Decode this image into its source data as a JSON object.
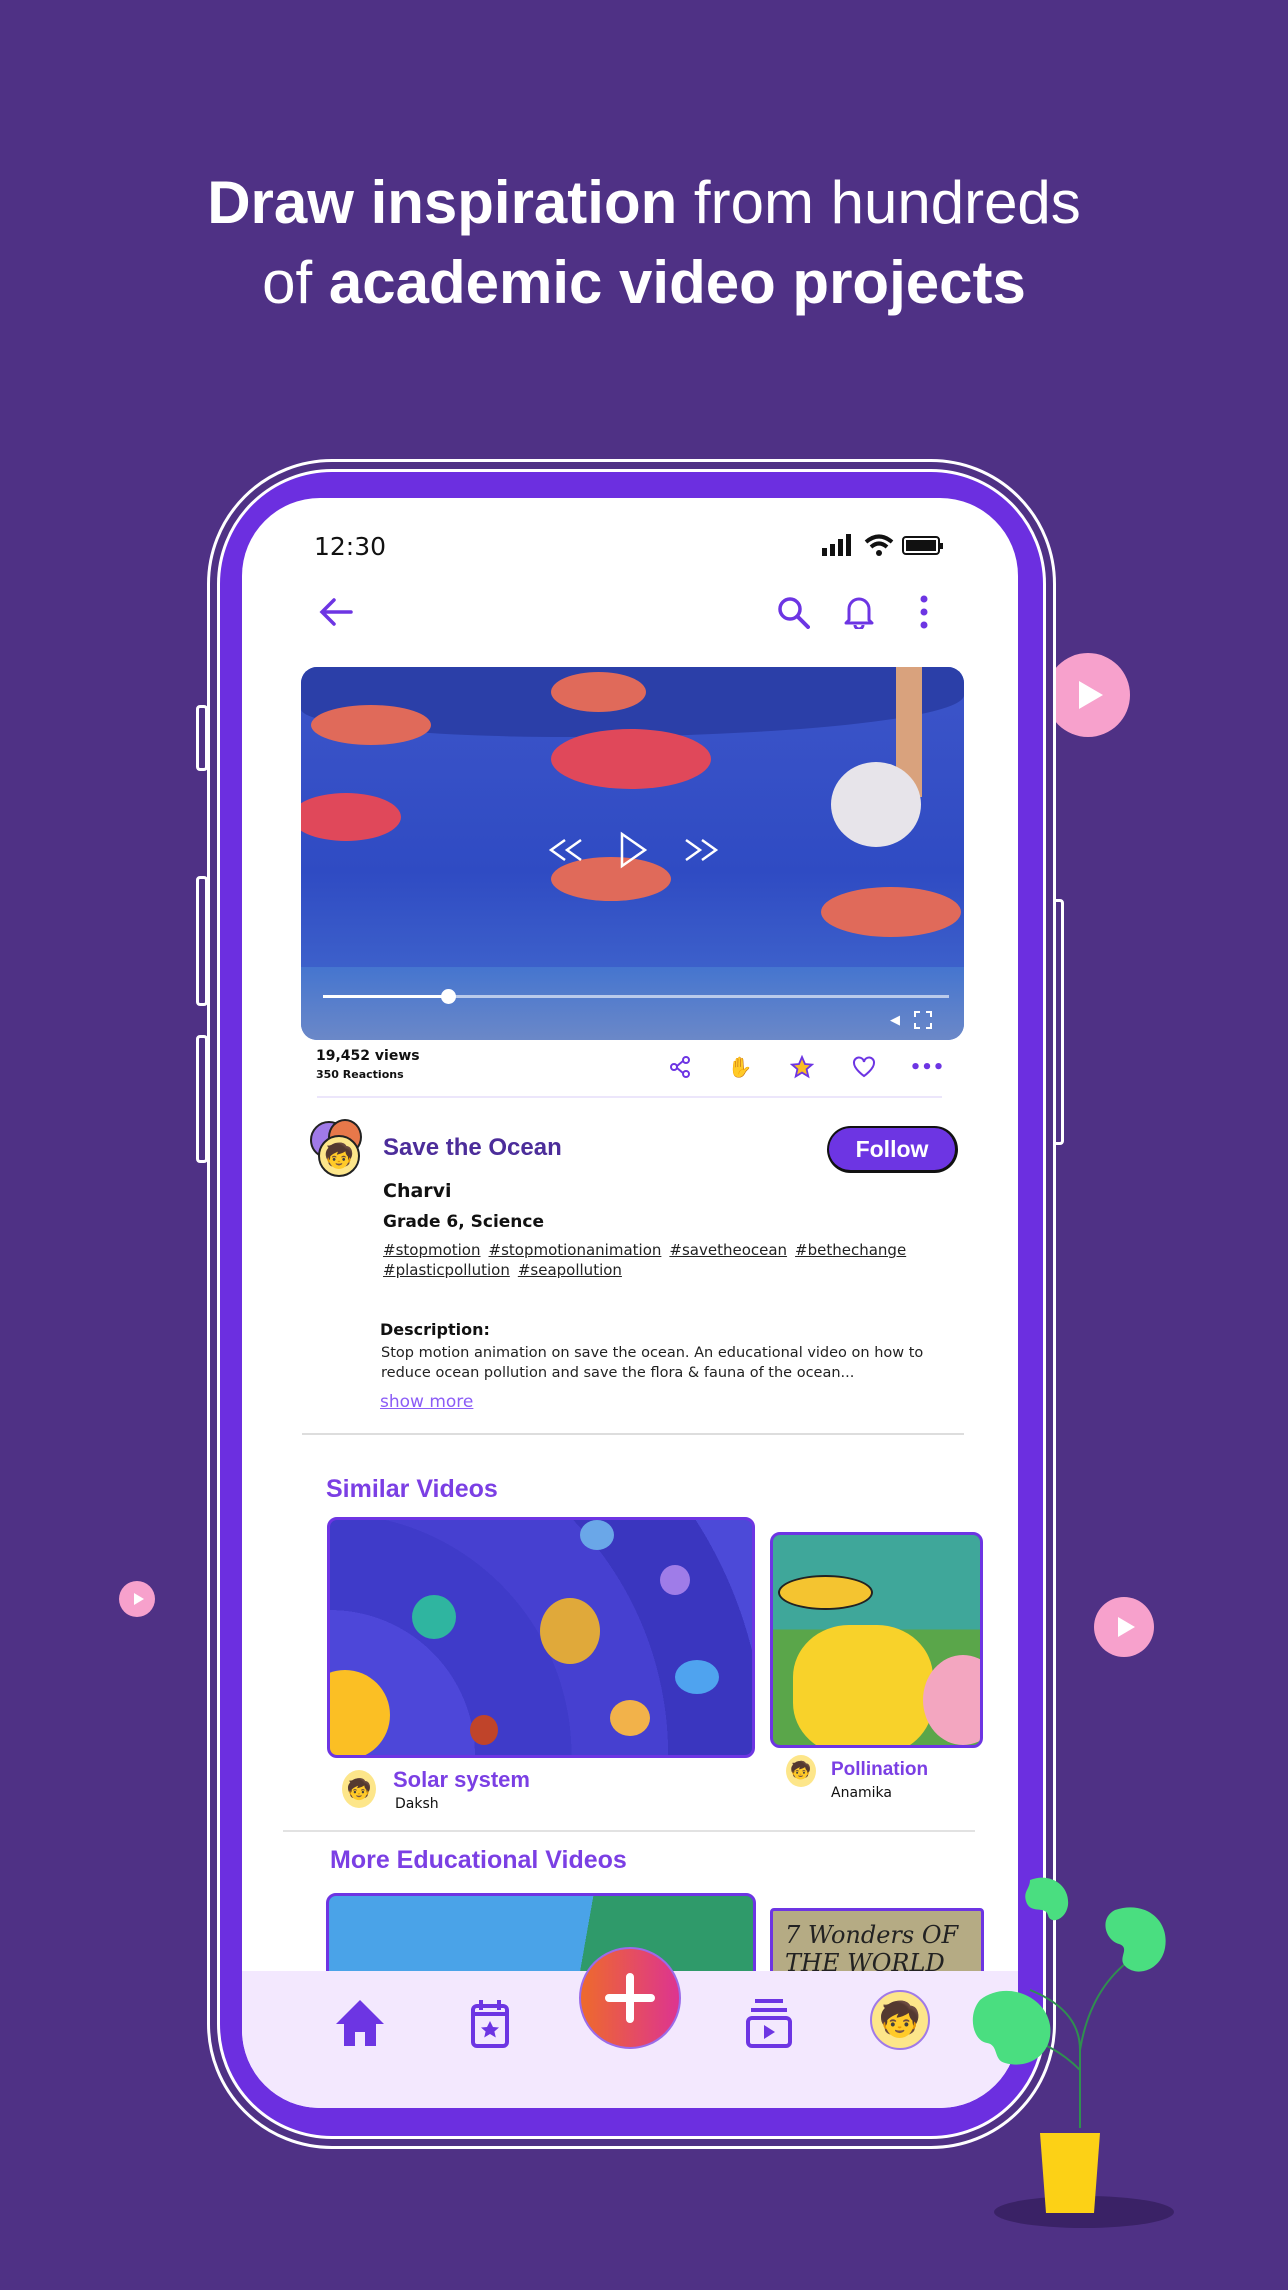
{
  "headline": {
    "line1_bold": "Draw inspiration",
    "line1_rest": " from hundreds",
    "line2_rest": "of ",
    "line2_bold": "academic video projects"
  },
  "status_bar": {
    "time": "12:30"
  },
  "top_bar": {
    "back_icon": "arrow-left-icon",
    "actions": [
      "search-icon",
      "bell-icon",
      "more-vertical-icon"
    ]
  },
  "video": {
    "progress_percent": 20,
    "controls": [
      "rewind-icon",
      "play-icon",
      "fast-forward-icon",
      "volume-icon",
      "fullscreen-icon"
    ]
  },
  "stats": {
    "views": "19,452 views",
    "reactions": "350 Reactions",
    "actions": [
      "share-icon",
      "clap-icon",
      "star-icon",
      "heart-icon",
      "more-horizontal-icon"
    ]
  },
  "project": {
    "title": "Save the Ocean",
    "follow_label": "Follow",
    "author": "Charvi",
    "grade": "Grade 6, Science",
    "tags": [
      "#stopmotion",
      "#stopmotionanimation",
      "#savetheocean",
      "#bethechange",
      "#plasticpollution",
      "#seapollution"
    ],
    "description_label": "Description:",
    "description": "Stop motion animation on save the ocean. An educational video on how to reduce ocean pollution and save the flora & fauna of the ocean...",
    "show_more": "show more"
  },
  "similar": {
    "title": "Similar Videos",
    "items": [
      {
        "title": "Solar system",
        "author": "Daksh"
      },
      {
        "title": "Pollination",
        "author": "Anamika"
      }
    ]
  },
  "more": {
    "title": "More Educational Videos",
    "items": [
      {
        "thumb_text": ""
      },
      {
        "thumb_text": "7 Wonders OF THE WORLD"
      }
    ]
  },
  "bottom_nav": {
    "items": [
      "home-icon",
      "calendar-star-icon",
      "plus-icon",
      "video-library-icon",
      "profile-avatar"
    ]
  },
  "colors": {
    "background": "#4f3185",
    "accent": "#6d35e3",
    "nav_bg": "#f3e8fe",
    "bubble": "#f7a1cc",
    "leaf": "#4ade80",
    "pot": "#fcd116"
  }
}
